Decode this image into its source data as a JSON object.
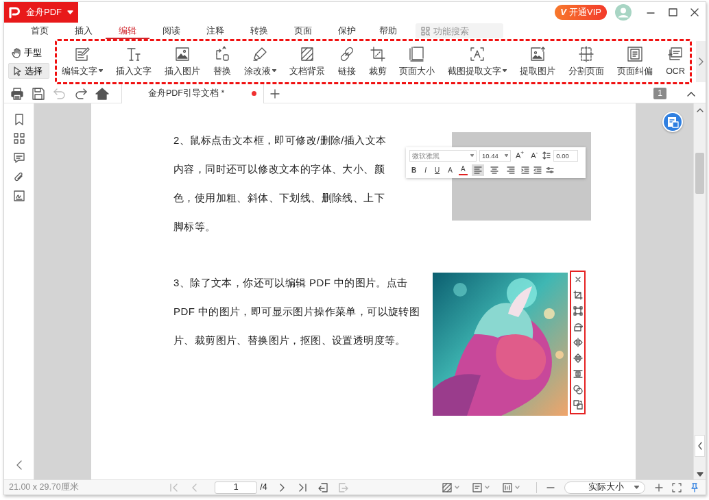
{
  "app": {
    "name": "金舟PDF"
  },
  "vip": {
    "badge": "V",
    "label": "开通VIP"
  },
  "menu_tabs": [
    {
      "label": "首页",
      "selected": false
    },
    {
      "label": "插入",
      "selected": false
    },
    {
      "label": "编辑",
      "selected": true
    },
    {
      "label": "阅读",
      "selected": false
    },
    {
      "label": "注释",
      "selected": false
    },
    {
      "label": "转换",
      "selected": false
    },
    {
      "label": "页面",
      "selected": false
    },
    {
      "label": "保护",
      "selected": false
    },
    {
      "label": "帮助",
      "selected": false
    }
  ],
  "search": {
    "placeholder": "功能搜索"
  },
  "modes": [
    {
      "label": "手型",
      "selected": false
    },
    {
      "label": "选择",
      "selected": true
    }
  ],
  "tools": [
    {
      "label": "编辑文字",
      "has_menu": true
    },
    {
      "label": "插入文字",
      "has_menu": false
    },
    {
      "label": "插入图片",
      "has_menu": false
    },
    {
      "label": "替换",
      "has_menu": false
    },
    {
      "label": "涂改液",
      "has_menu": true
    },
    {
      "label": "文档背景",
      "has_menu": false
    },
    {
      "label": "链接",
      "has_menu": false
    },
    {
      "label": "裁剪",
      "has_menu": false
    },
    {
      "label": "页面大小",
      "has_menu": false
    },
    {
      "label": "截图提取文字",
      "has_menu": true
    },
    {
      "label": "提取图片",
      "has_menu": false
    },
    {
      "label": "分割页面",
      "has_menu": false
    },
    {
      "label": "页面纠偏",
      "has_menu": false
    },
    {
      "label": "OCR",
      "has_menu": false
    }
  ],
  "quick_actions": [
    {
      "kind": "print",
      "disabled": false
    },
    {
      "kind": "save",
      "disabled": false
    },
    {
      "kind": "undo",
      "disabled": true
    },
    {
      "kind": "redo",
      "disabled": false
    },
    {
      "kind": "home",
      "disabled": false
    }
  ],
  "document_tab": {
    "title": "金舟PDF引导文档 *",
    "unsaved": true,
    "selected": true
  },
  "page_badge": "1",
  "document": {
    "paragraphs": [
      {
        "lines": [
          "2、鼠标点击文本框，即可修改/删除/插入文本",
          "内容，同时还可以修改文本的字体、大小、颜",
          "色，使用加粗、斜体、下划线、删除线、上下",
          "脚标等。"
        ]
      },
      {
        "lines": [
          "3、除了文本，你还可以编辑 PDF 中的图片。点击",
          "PDF 中的图片，即可显示图片操作菜单，可以旋转图",
          "片、裁剪图片、替换图片，抠图、设置透明度等。"
        ]
      }
    ],
    "format_bar": {
      "font": "微软雅黑",
      "size": "10.44",
      "size_buttons": [
        "A$^{+}$",
        "A$^{-}$"
      ],
      "line_spacing": "0.00",
      "style_buttons": [
        {
          "kind": "bold",
          "label": "B"
        },
        {
          "kind": "italic",
          "label": "I"
        },
        {
          "kind": "underline",
          "label": "U"
        },
        {
          "kind": "plain",
          "label": "A"
        }
      ],
      "color_button": {
        "label": "A",
        "color": "#e02020"
      },
      "align_buttons": [
        {
          "kind": "left",
          "selected": true
        },
        {
          "kind": "center",
          "selected": false
        },
        {
          "kind": "right",
          "selected": false
        }
      ]
    }
  },
  "status_bar": {
    "page_size": "21.00 x 29.70厘米",
    "nav_buttons": [
      {
        "kind": "first",
        "disabled": true
      },
      {
        "kind": "prev",
        "disabled": true
      }
    ],
    "page_input": "1",
    "page_total": "/4",
    "nav_buttons_after": [
      {
        "kind": "next",
        "disabled": false
      },
      {
        "kind": "last",
        "disabled": false
      },
      {
        "kind": "back",
        "disabled": false
      },
      {
        "kind": "forward",
        "disabled": true
      }
    ],
    "zoom": "实际大小"
  }
}
